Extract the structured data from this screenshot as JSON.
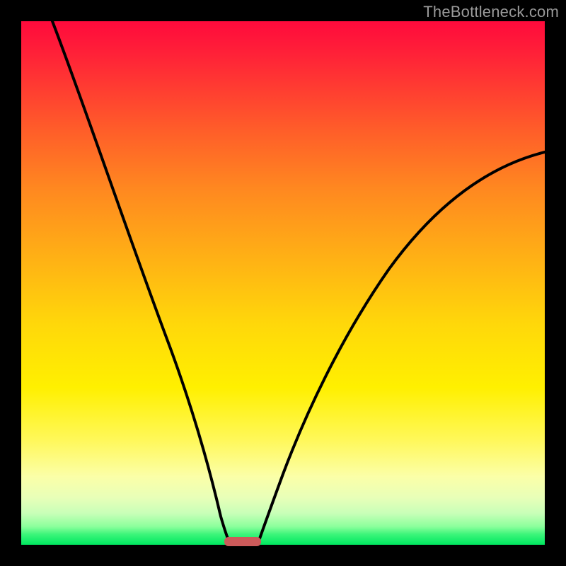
{
  "watermark": {
    "text": "TheBottleneck.com"
  },
  "colors": {
    "background": "#000000",
    "curve": "#000000",
    "marker": "#cc5a5a",
    "watermark": "#9a9a9a"
  },
  "chart_data": {
    "type": "line",
    "title": "",
    "xlabel": "",
    "ylabel": "",
    "xlim": [
      0,
      100
    ],
    "ylim": [
      0,
      100
    ],
    "grid": false,
    "legend": false,
    "marker": {
      "x_center": 42,
      "width": 7,
      "y": 0
    },
    "series": [
      {
        "name": "left-branch",
        "x": [
          6,
          10,
          15,
          20,
          25,
          30,
          34,
          36.5,
          38,
          39.5
        ],
        "y": [
          100,
          88,
          73,
          58,
          43,
          28,
          15,
          7,
          2.5,
          0.8
        ]
      },
      {
        "name": "right-branch",
        "x": [
          45,
          47,
          50,
          55,
          62,
          70,
          80,
          90,
          100
        ],
        "y": [
          0.8,
          3,
          9,
          22,
          38,
          51,
          62,
          70,
          75
        ]
      }
    ],
    "gradient_stops": [
      {
        "pct": 0,
        "color": "#ff0a3c"
      },
      {
        "pct": 20,
        "color": "#ff5a2a"
      },
      {
        "pct": 45,
        "color": "#ffb015"
      },
      {
        "pct": 70,
        "color": "#fff000"
      },
      {
        "pct": 90,
        "color": "#e8ffb8"
      },
      {
        "pct": 100,
        "color": "#00e860"
      }
    ]
  }
}
